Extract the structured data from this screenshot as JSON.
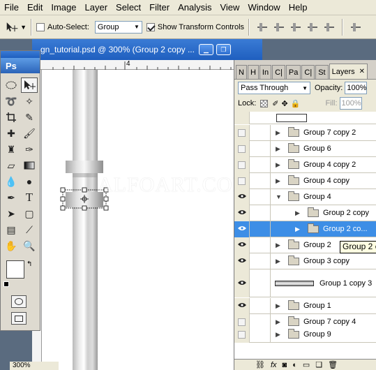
{
  "menu": [
    "File",
    "Edit",
    "Image",
    "Layer",
    "Select",
    "Filter",
    "Analysis",
    "View",
    "Window",
    "Help"
  ],
  "options": {
    "auto_select_label": "Auto-Select:",
    "auto_select_checked": false,
    "auto_select_value": "Group",
    "show_transform_label": "Show Transform Controls",
    "show_transform_checked": true
  },
  "document": {
    "title": "gn_tutorial.psd @ 300% (Group 2 copy ...",
    "ruler_mark": "4",
    "watermark": "ALFOART.COM",
    "zoom": "300%"
  },
  "tools": {
    "app_label": "Ps"
  },
  "layers_panel": {
    "tabs": [
      "N",
      "H",
      "In",
      "C|",
      "Pa",
      "C|",
      "St",
      "Layers"
    ],
    "blend_mode": "Pass Through",
    "opacity_label": "Opacity:",
    "opacity_value": "100%",
    "lock_label": "Lock:",
    "fill_label": "Fill:",
    "fill_value": "100%",
    "layers": [
      {
        "name": "Group 7 copy 2",
        "visible": false,
        "indent": 0
      },
      {
        "name": "Group 6",
        "visible": false,
        "indent": 0
      },
      {
        "name": "Group 4 copy 2",
        "visible": false,
        "indent": 0
      },
      {
        "name": "Group 4 copy",
        "visible": false,
        "indent": 0
      },
      {
        "name": "Group 4",
        "visible": true,
        "indent": 0,
        "expanded": true
      },
      {
        "name": "Group 2 copy",
        "visible": true,
        "indent": 1
      },
      {
        "name": "Group 2 co...",
        "visible": true,
        "indent": 1,
        "selected": true
      },
      {
        "name": "Group 2",
        "visible": true,
        "indent": 0
      },
      {
        "name": "Group 3 copy",
        "visible": true,
        "indent": 0
      },
      {
        "name": "Group 1 copy 3",
        "visible": true,
        "indent": 0,
        "thumb": true
      },
      {
        "name": "Group 1",
        "visible": true,
        "indent": 0
      },
      {
        "name": "Group 7 copy 4",
        "visible": false,
        "indent": 0
      },
      {
        "name": "Group 9",
        "visible": false,
        "indent": 0
      }
    ],
    "tooltip": "Group 2 c"
  }
}
